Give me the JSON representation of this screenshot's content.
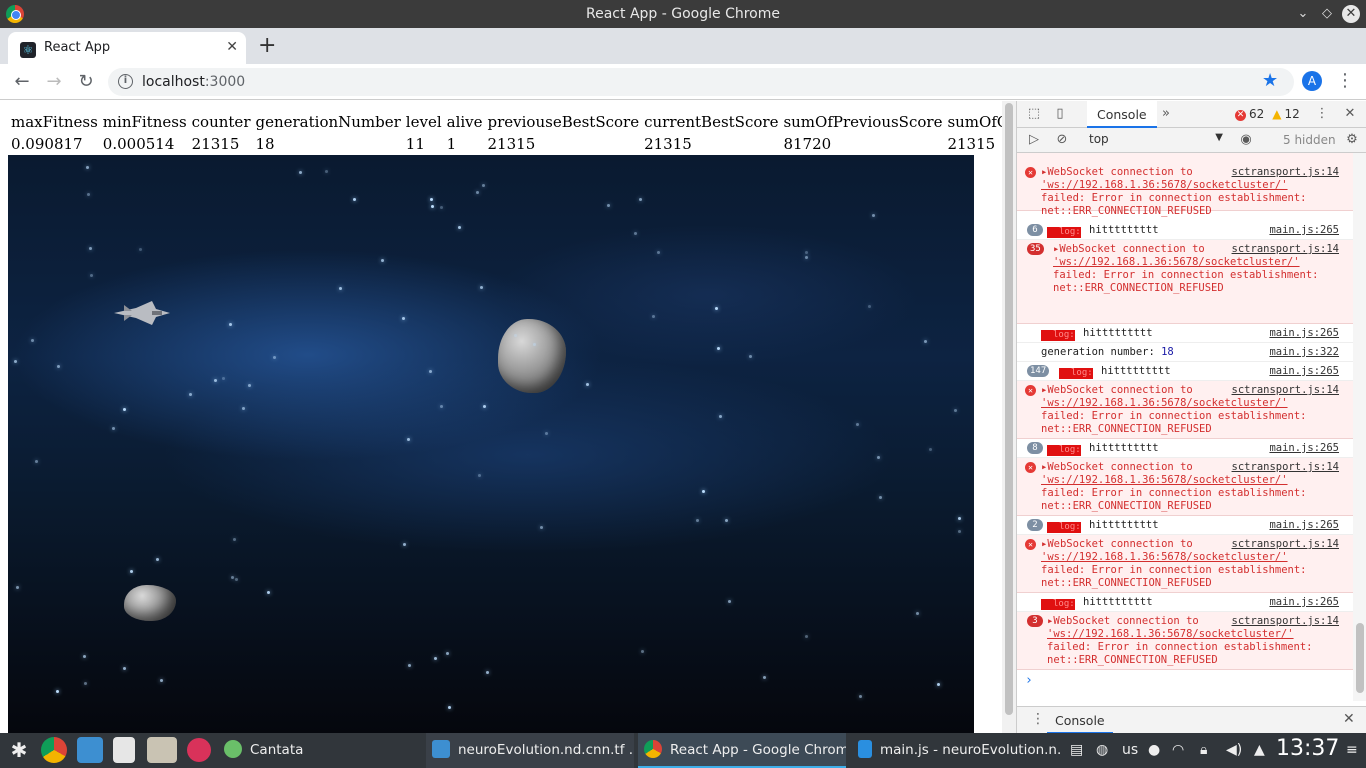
{
  "window": {
    "title": "React App - Google Chrome"
  },
  "browser": {
    "tab_title": "React App",
    "new_tab_icon": "plus-icon",
    "url_host": "localhost",
    "url_port": ":3000",
    "profile_initial": "A"
  },
  "stats": {
    "headers": [
      "maxFitness",
      "minFitness",
      "counter",
      "generationNumber",
      "level",
      "alive",
      "previouseBestScore",
      "currentBestScore",
      "sumOfPreviousScore",
      "sumOfCurrentScore"
    ],
    "values": [
      "0.090817",
      "0.000514",
      "21315",
      "18",
      "11",
      "1",
      "21315",
      "21315",
      "81720",
      "21315"
    ]
  },
  "devtools": {
    "tab_console": "Console",
    "errors_count": "62",
    "warnings_count": "12",
    "context": "top",
    "hidden": "5 hidden",
    "drawer_tab": "Console"
  },
  "console": {
    "ws_msg_a": "WebSocket connection to ",
    "ws_url": "'ws://192.168.1.36:5678/socketcluster/'",
    "ws_failed": "failed: Error in connection establishment:",
    "ws_refused": "net::ERR_CONNECTION_REFUSED",
    "src_sct": "sctransport.js:14",
    "src_main265": "main.js:265",
    "src_main322": "main.js:322",
    "log_label": "log:",
    "hit": "hittttttttt",
    "gen_label": "generation number: ",
    "gen_value": "18",
    "counts": [
      "6",
      "35",
      "147",
      "8",
      "2",
      "3"
    ]
  },
  "taskbar": {
    "items": [
      "Cantata",
      "neuroEvolution.nd.cnn.tf ...",
      "React App - Google Chrome",
      "main.js - neuroEvolution.n..."
    ],
    "keyboard": "us",
    "time": "13:37"
  },
  "colors": {
    "accent": "#1a73e8",
    "error": "#d32f2f",
    "taskbar": "#31363b"
  }
}
